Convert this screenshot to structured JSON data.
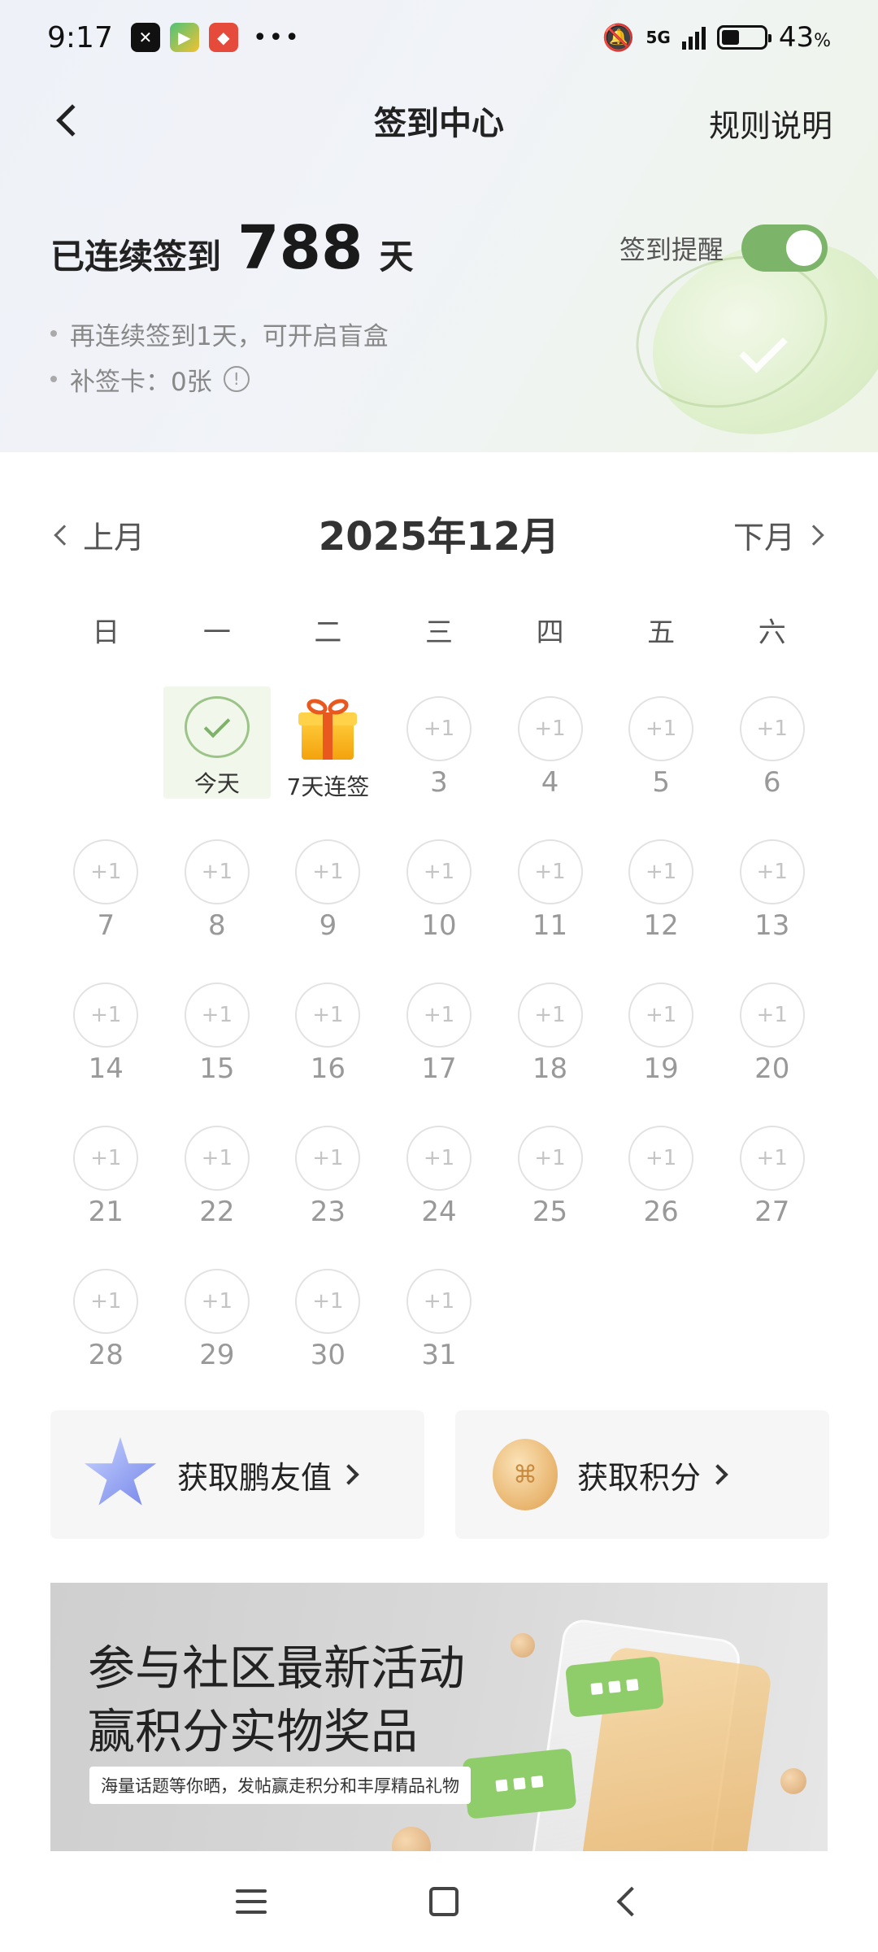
{
  "status_bar": {
    "time": "9:17",
    "network": "5G",
    "battery_percent_value": "43",
    "battery_percent_unit": "%",
    "battery_level": 0.43
  },
  "nav": {
    "title": "签到中心",
    "rules": "规则说明"
  },
  "streak": {
    "prefix": "已连续签到",
    "count": "788",
    "unit": "天"
  },
  "reminder": {
    "label": "签到提醒",
    "enabled": true
  },
  "tips": {
    "line1": "再连续签到1天，可开启盲盒",
    "line2": "补签卡：0张"
  },
  "calendar": {
    "month_title": "2025年12月",
    "prev": "上月",
    "next": "下月",
    "weekdays": [
      "日",
      "一",
      "二",
      "三",
      "四",
      "五",
      "六"
    ],
    "reward": "+1",
    "today_label": "今天",
    "gift_label": "7天连签",
    "days": [
      "3",
      "4",
      "5",
      "6",
      "7",
      "8",
      "9",
      "10",
      "11",
      "12",
      "13",
      "14",
      "15",
      "16",
      "17",
      "18",
      "19",
      "20",
      "21",
      "22",
      "23",
      "24",
      "25",
      "26",
      "27",
      "28",
      "29",
      "30",
      "31"
    ]
  },
  "cards": {
    "friend_value": "获取鹏友值",
    "points": "获取积分"
  },
  "banner": {
    "line1": "参与社区最新活动",
    "line2": "赢积分实物奖品",
    "subtitle": "海量话题等你晒，发帖赢走积分和丰厚精品礼物"
  },
  "colors": {
    "accent_green": "#7cb56a",
    "today_bg": "#f1f7ea"
  }
}
